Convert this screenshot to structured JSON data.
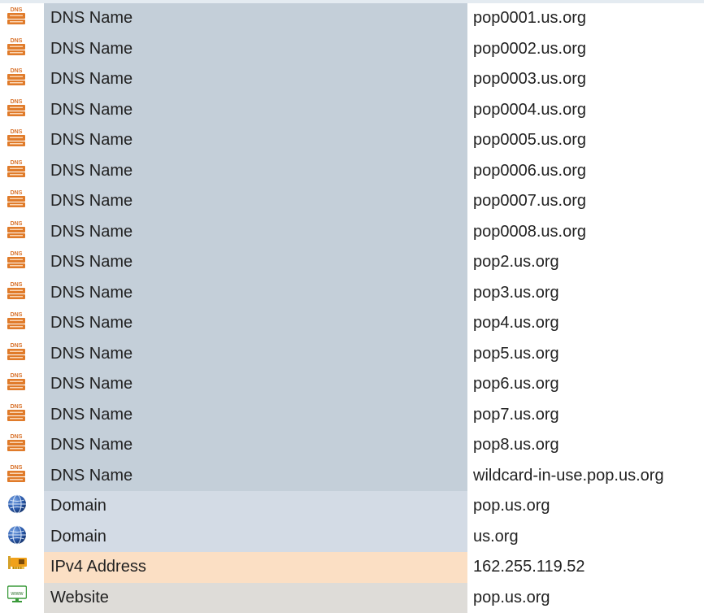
{
  "colors": {
    "dns_type_bg": "#c4cfd9",
    "domain_type_bg": "#d3dbe5",
    "ipv4_type_bg": "#fbdfc4",
    "website_type_bg": "#dedcd8",
    "dns_icon": "#e07b2a"
  },
  "icons": {
    "dns": "dns-server-icon",
    "domain": "globe-icon",
    "ipv4": "network-card-icon",
    "website": "www-monitor-icon"
  },
  "dns_icon_text": "DNS",
  "www_icon_text": "www",
  "rows": [
    {
      "kind": "dns",
      "type": "DNS Name",
      "value": "pop0001.us.org"
    },
    {
      "kind": "dns",
      "type": "DNS Name",
      "value": "pop0002.us.org"
    },
    {
      "kind": "dns",
      "type": "DNS Name",
      "value": "pop0003.us.org"
    },
    {
      "kind": "dns",
      "type": "DNS Name",
      "value": "pop0004.us.org"
    },
    {
      "kind": "dns",
      "type": "DNS Name",
      "value": "pop0005.us.org"
    },
    {
      "kind": "dns",
      "type": "DNS Name",
      "value": "pop0006.us.org"
    },
    {
      "kind": "dns",
      "type": "DNS Name",
      "value": "pop0007.us.org"
    },
    {
      "kind": "dns",
      "type": "DNS Name",
      "value": "pop0008.us.org"
    },
    {
      "kind": "dns",
      "type": "DNS Name",
      "value": "pop2.us.org"
    },
    {
      "kind": "dns",
      "type": "DNS Name",
      "value": "pop3.us.org"
    },
    {
      "kind": "dns",
      "type": "DNS Name",
      "value": "pop4.us.org"
    },
    {
      "kind": "dns",
      "type": "DNS Name",
      "value": "pop5.us.org"
    },
    {
      "kind": "dns",
      "type": "DNS Name",
      "value": "pop6.us.org"
    },
    {
      "kind": "dns",
      "type": "DNS Name",
      "value": "pop7.us.org"
    },
    {
      "kind": "dns",
      "type": "DNS Name",
      "value": "pop8.us.org"
    },
    {
      "kind": "dns",
      "type": "DNS Name",
      "value": "wildcard-in-use.pop.us.org"
    },
    {
      "kind": "domain",
      "type": "Domain",
      "value": "pop.us.org"
    },
    {
      "kind": "domain",
      "type": "Domain",
      "value": "us.org"
    },
    {
      "kind": "ipv4",
      "type": "IPv4 Address",
      "value": "162.255.119.52"
    },
    {
      "kind": "website",
      "type": "Website",
      "value": "pop.us.org"
    }
  ]
}
